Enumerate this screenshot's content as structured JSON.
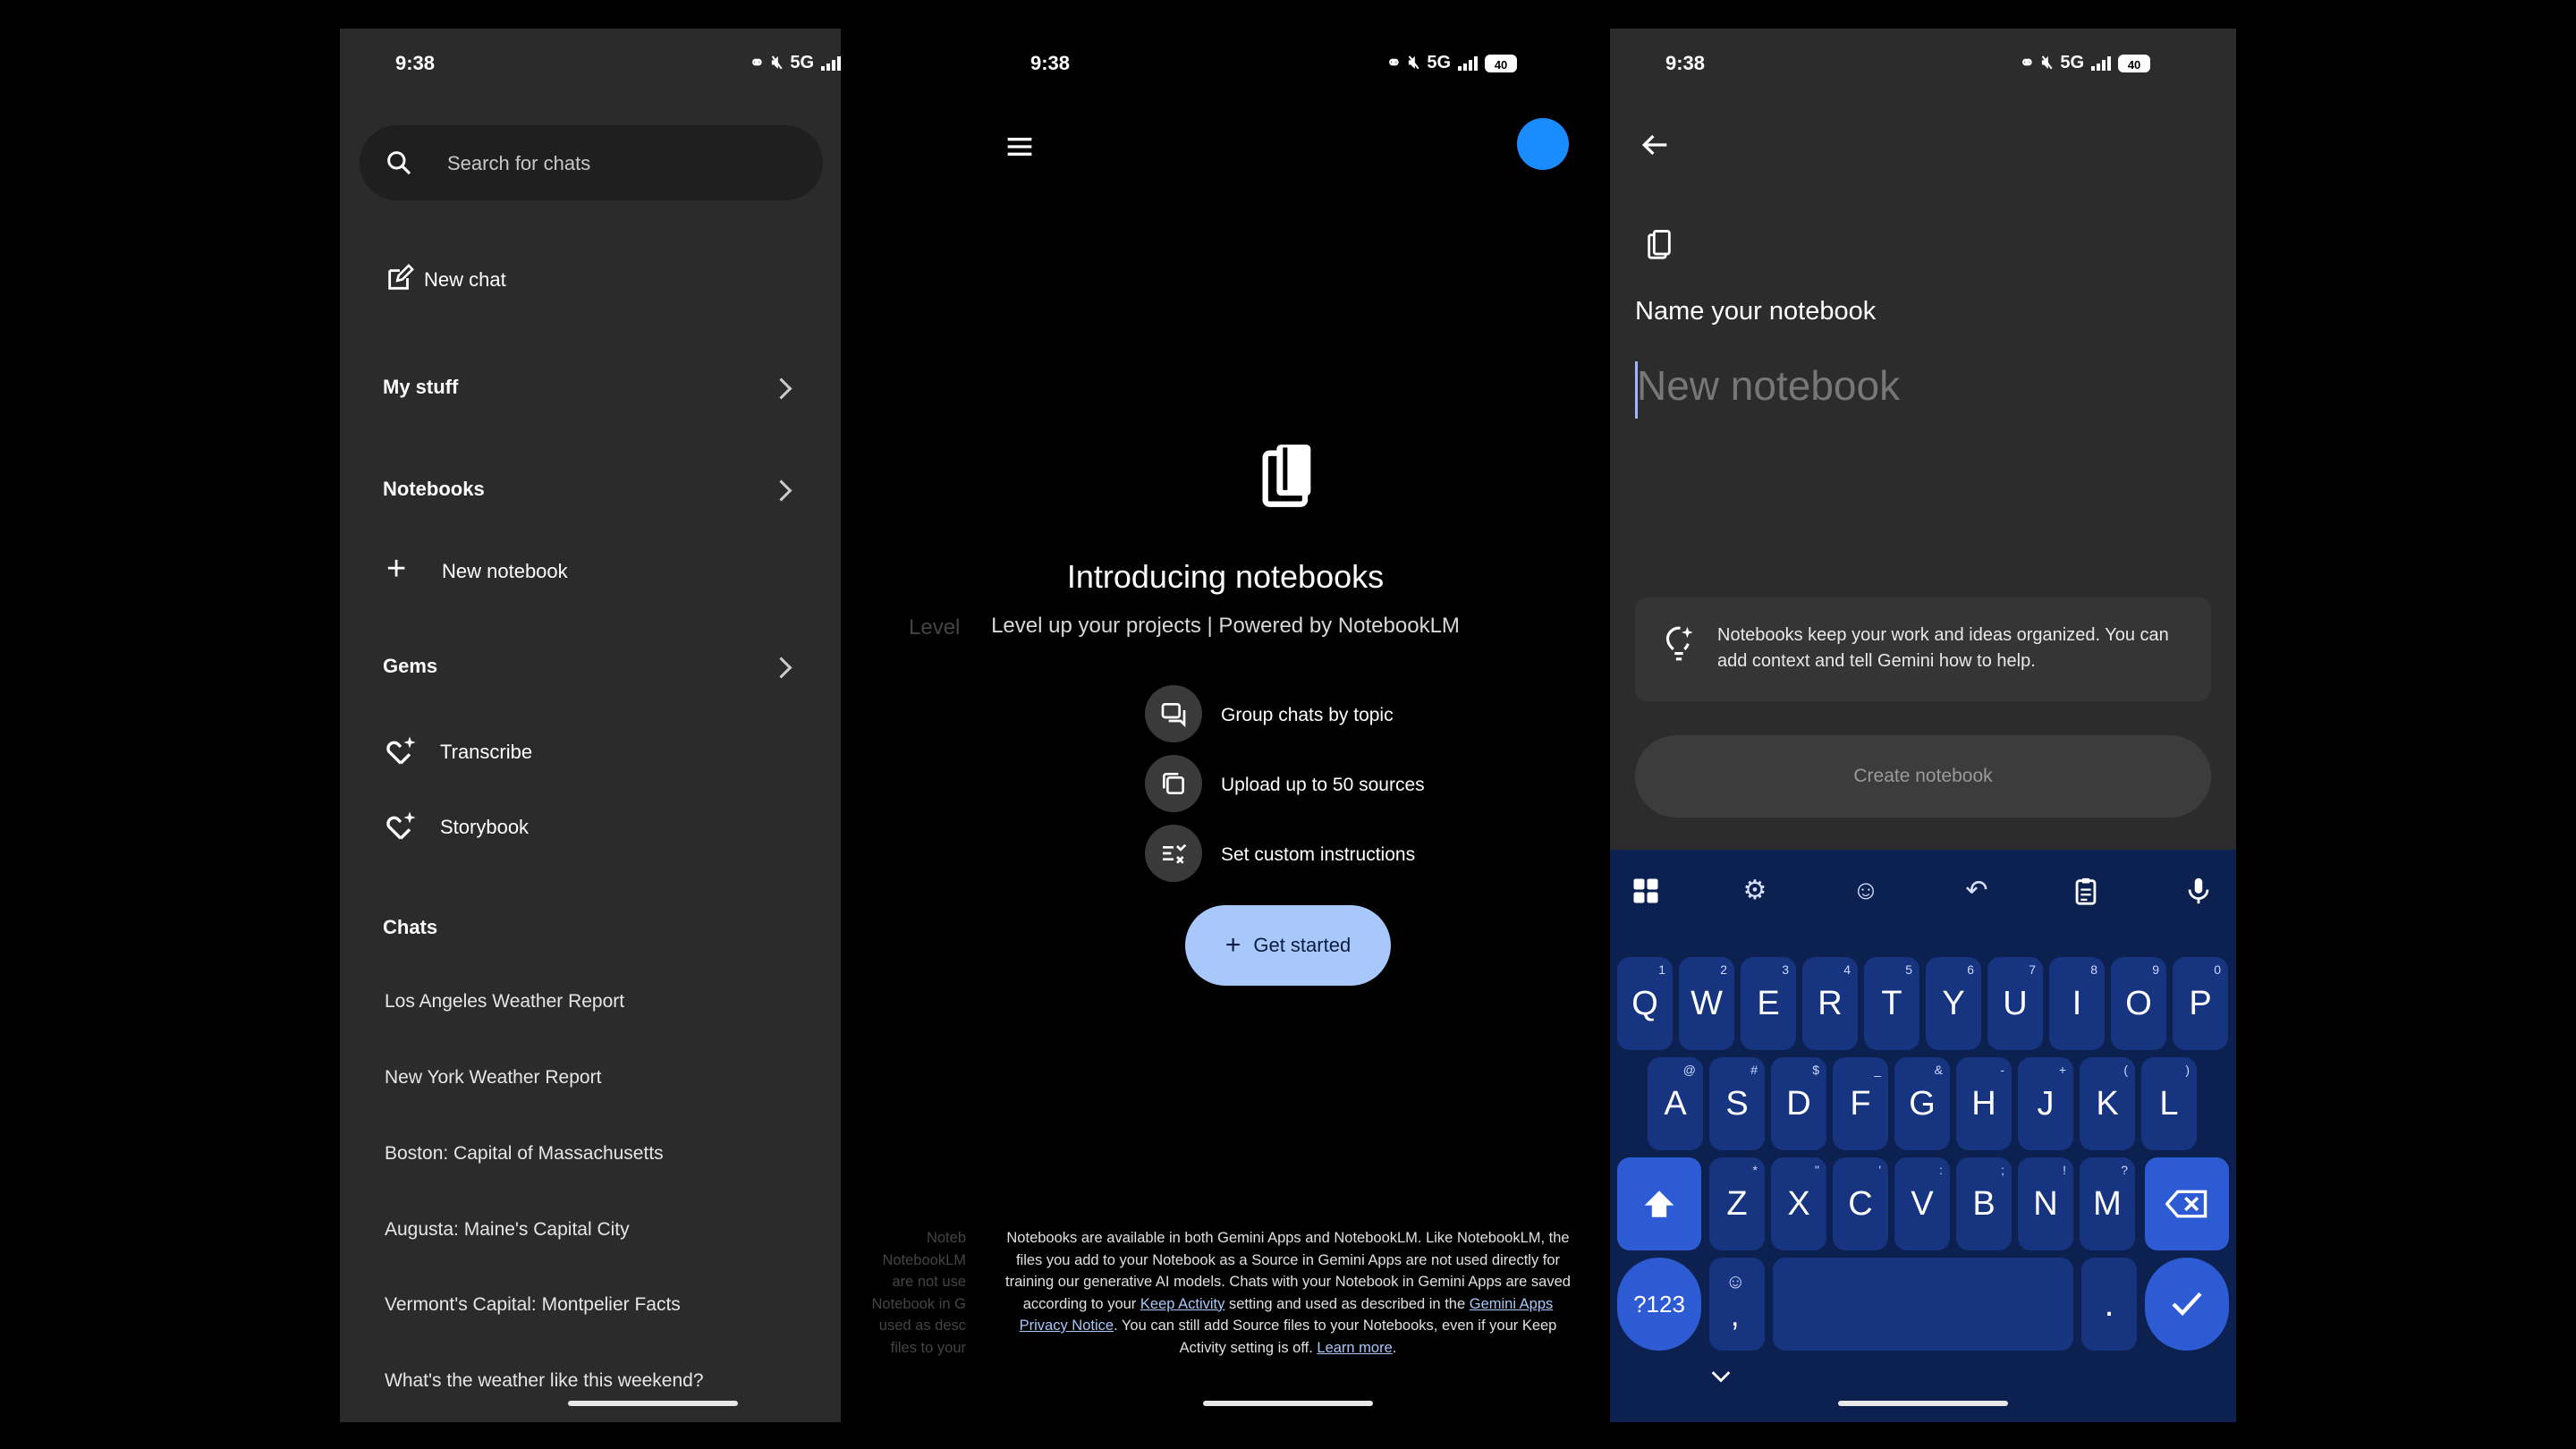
{
  "status_bar": {
    "time": "9:38",
    "network": "5G",
    "battery": "40"
  },
  "drawer": {
    "search_placeholder": "Search for chats",
    "new_chat": "New chat",
    "my_stuff": "My stuff",
    "notebooks": "Notebooks",
    "new_notebook": "New notebook",
    "gems": "Gems",
    "gem_items": [
      "Transcribe",
      "Storybook"
    ],
    "chats_heading": "Chats",
    "chats": [
      "Los Angeles Weather Report",
      "New York Weather Report",
      "Boston: Capital of Massachusetts",
      "Augusta: Maine's Capital City",
      "Vermont's Capital: Montpelier Facts",
      "What's the weather like this weekend?"
    ]
  },
  "intro": {
    "ghost_level": "Level",
    "title": "Introducing notebooks",
    "subtitle": "Level up your projects | Powered by NotebookLM",
    "features": [
      "Group chats by topic",
      "Upload up to 50 sources",
      "Set custom instructions"
    ],
    "get_started": "Get started",
    "legal_1": "Notebooks are available in both Gemini Apps and NotebookLM. Like NotebookLM, the files you add to your Notebook as a Source in Gemini Apps are not used directly for training our generative AI models. Chats with your Notebook in Gemini Apps are saved according to your",
    "link_keep_activity": "Keep Activity",
    "legal_2": "setting and used as described in the",
    "link_privacy": "Gemini Apps Privacy Notice",
    "legal_3": ". You can still add Source files to your Notebooks, even if your Keep Activity setting is off.",
    "link_learn_more": "Learn more",
    "ghost_legal": [
      "Noteb",
      "NotebookLM",
      "are not use",
      "Notebook in G",
      "used as desc",
      "files to your"
    ]
  },
  "name_notebook": {
    "title": "Name your notebook",
    "input_placeholder": "New notebook",
    "info": "Notebooks keep your work and ideas organized. You can add context and tell Gemini how to help.",
    "create_button": "Create notebook"
  },
  "keyboard": {
    "row1": [
      "Q",
      "W",
      "E",
      "R",
      "T",
      "Y",
      "U",
      "I",
      "O",
      "P"
    ],
    "row1_sup": [
      "1",
      "2",
      "3",
      "4",
      "5",
      "6",
      "7",
      "8",
      "9",
      "0"
    ],
    "row2": [
      "A",
      "S",
      "D",
      "F",
      "G",
      "H",
      "J",
      "K",
      "L"
    ],
    "row2_sup": [
      "@",
      "#",
      "$",
      "_",
      "&",
      "-",
      "+",
      "(",
      ")"
    ],
    "row3": [
      "Z",
      "X",
      "C",
      "V",
      "B",
      "N",
      "M"
    ],
    "row3_sup": [
      "*",
      "\"",
      "'",
      ":",
      ";",
      "!",
      "?"
    ],
    "symbols_key": "?123",
    "comma_key": ",",
    "period_key": "."
  },
  "colors": {
    "accent_blue": "#a8c7fa",
    "keyboard_bg": "#0d2150",
    "key_bg": "#173480",
    "avatar": "#1a8cff"
  }
}
